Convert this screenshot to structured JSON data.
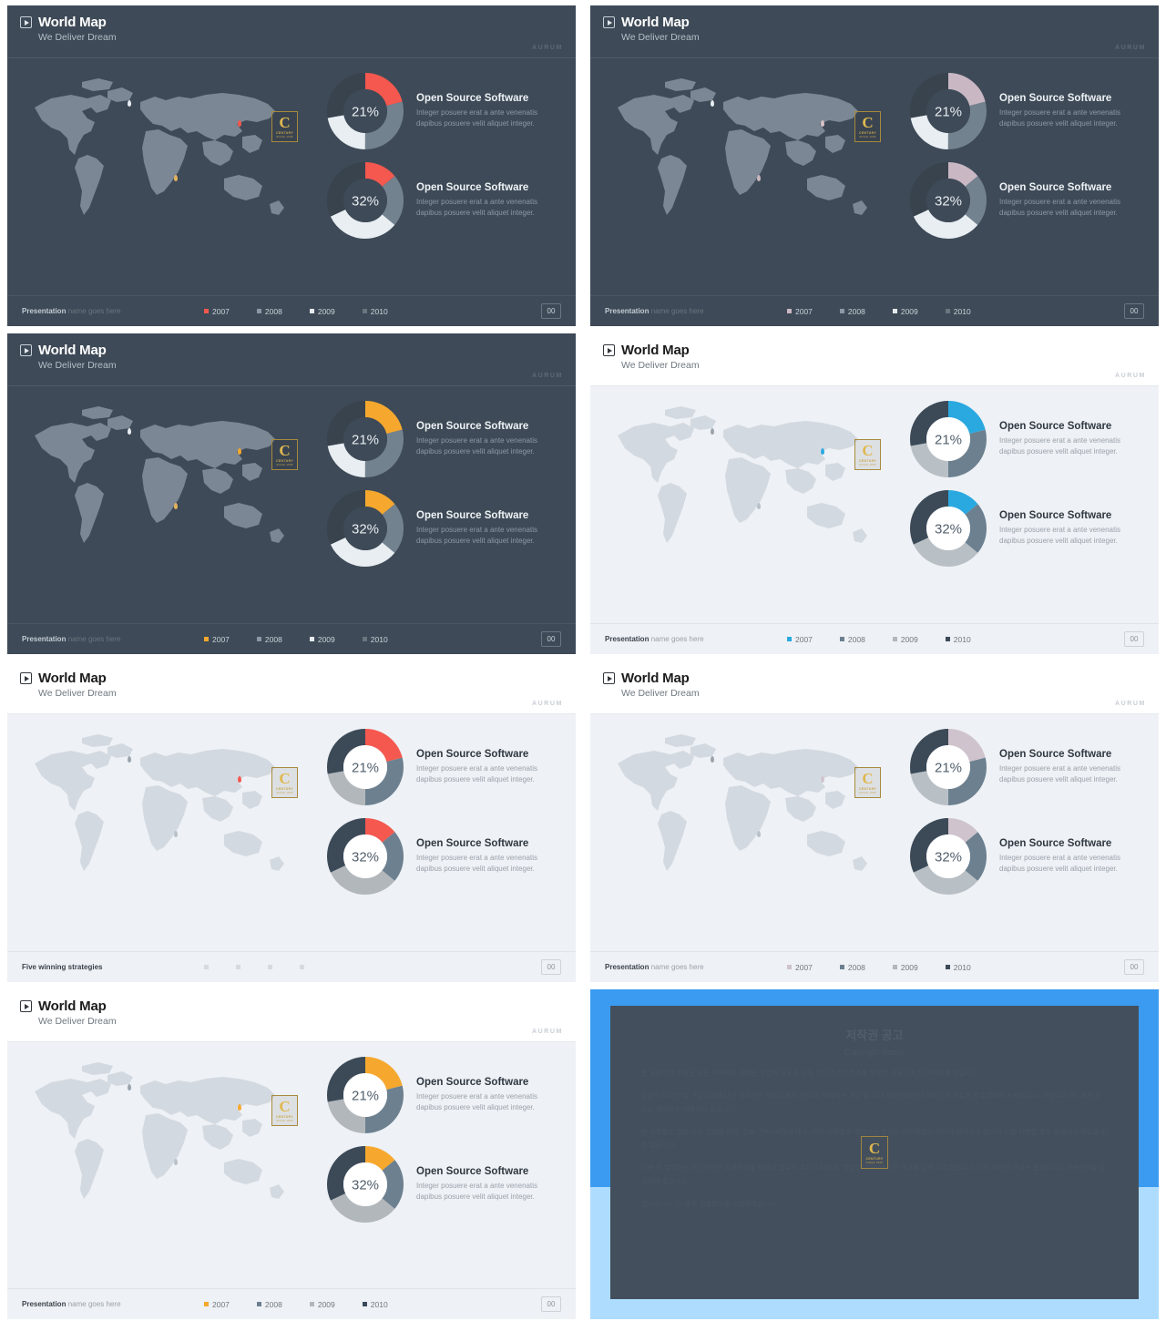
{
  "header": {
    "title": "World Map",
    "subtitle": "We Deliver Dream",
    "brand": "AURUM",
    "play_icon": "play-icon"
  },
  "charts": [
    {
      "value_label": "21%",
      "title": "Open Source Software",
      "text": "Integer posuere erat a ante venenatis dapibus posuere velit aliquet integer."
    },
    {
      "value_label": "32%",
      "title": "Open Source Software",
      "text": "Integer posuere erat a ante venenatis dapibus posuere velit aliquet integer."
    }
  ],
  "footer": {
    "name_strong": "Presentation",
    "name_light": "name goes here",
    "alt_name_strong": "Five winning strategies",
    "page": "00",
    "legend": [
      "2007",
      "2008",
      "2009",
      "2010"
    ]
  },
  "chart_data": {
    "type": "pie",
    "title": "Open Source Software donut breakdown",
    "charts": [
      {
        "center_label": "21%",
        "categories": [
          "2007",
          "2008",
          "2009",
          "2010"
        ],
        "values": [
          21,
          29,
          22,
          28
        ]
      },
      {
        "center_label": "32%",
        "categories": [
          "2007",
          "2008",
          "2009",
          "2010"
        ],
        "values": [
          14,
          22,
          32,
          32
        ]
      }
    ],
    "legend_position": "footer",
    "grid": false
  },
  "slides": [
    {
      "id": "slide-1-dark-red",
      "theme": "dark",
      "accent": "#f4584f",
      "footer_variant": "presentation",
      "donut_colors": [
        "#f4584f",
        "#73828f",
        "#e8eef2",
        "#39434e"
      ],
      "pin_colors": [
        "#e9eef2",
        "#f4584f",
        "#e3b25b"
      ]
    },
    {
      "id": "slide-2-dark-mauve",
      "theme": "dark",
      "accent": "#c9b8c4",
      "footer_variant": "presentation",
      "donut_colors": [
        "#c9b8c4",
        "#73828f",
        "#e8eef2",
        "#39434e"
      ],
      "pin_colors": [
        "#e9eef2",
        "#d9c3c9",
        "#cbb7be"
      ]
    },
    {
      "id": "slide-3-dark-orange",
      "theme": "dark",
      "accent": "#f6a82e",
      "footer_variant": "presentation",
      "donut_colors": [
        "#f6a82e",
        "#73828f",
        "#e8eef2",
        "#39434e"
      ],
      "pin_colors": [
        "#e9eef2",
        "#f6a82e",
        "#e3b25b"
      ]
    },
    {
      "id": "slide-4-light-blue",
      "theme": "light",
      "accent": "#2aa9e0",
      "footer_variant": "presentation",
      "donut_colors": [
        "#2aa9e0",
        "#6c808f",
        "#b8bfc5",
        "#3c4a58"
      ],
      "pin_colors": [
        "#9aa4ae",
        "#2aa9e0",
        "#b9c1c9"
      ]
    },
    {
      "id": "slide-5-light-red",
      "theme": "light",
      "accent": "#f4584f",
      "footer_variant": "strategies",
      "donut_colors": [
        "#f4584f",
        "#6c808f",
        "#b2b7bb",
        "#3c4a58"
      ],
      "pin_colors": [
        "#9aa4ae",
        "#f4584f",
        "#b9c1c9"
      ]
    },
    {
      "id": "slide-6-light-mauve",
      "theme": "light",
      "accent": "#cfc3cd",
      "footer_variant": "presentation",
      "donut_colors": [
        "#cfc3cd",
        "#6c808f",
        "#b8bfc5",
        "#3c4a58"
      ],
      "pin_colors": [
        "#9aa4ae",
        "#cfc3cd",
        "#b9c1c9"
      ]
    },
    {
      "id": "slide-7-light-orange",
      "theme": "light",
      "accent": "#f6a82e",
      "footer_variant": "presentation",
      "donut_colors": [
        "#f6a82e",
        "#6c808f",
        "#b2b7bb",
        "#3c4a58"
      ],
      "pin_colors": [
        "#9aa4ae",
        "#f6a82e",
        "#b9c1c9"
      ]
    }
  ],
  "copyright": {
    "title": "저작권 공고",
    "subtitle": "Copyright Notice",
    "paragraphs": [
      "본 템플릿에 사용된 모든 이미지와 서체는 상업적 용도로 사용 가능한 라이선스를 확보한 자료이며 무단 배포를 금합니다.",
      "템플릿 디자인 및 구성요소에 대한 저작권은 제작자에게 있으며, 구매자는 개인 및 사내 프레젠테이션 목적으로 자유롭게 수정하여 사용하실 수 있습니다. 단, 재판매 또는 재배포는 허용되지 않습니다.",
      "본 저작물의 일부 또는 전부를 복제, 전송, 전시, 배포하거나 2차적 저작물로 작성하는 행위는 저작권법에 의하여 금지되어 있으며 이를 위반할 경우 민형사상 책임을 질 수 있습니다.",
      "사용 중 발생하는 문의사항은 고객센터를 통하여 접수해 주시기 바라며, 영업일 기준 24시간 이내에 답변 드리겠습니다. 기타 자세한 안내는 홈페이지의 이용약관을 참고하여 주십시오.",
      "감사합니다. 더 좋은 템플릿으로 보답하겠습니다."
    ],
    "logo": "aurum-logo"
  },
  "logo": {
    "letter": "C",
    "line1": "CENTURY",
    "line2": "SINCE 1998"
  }
}
